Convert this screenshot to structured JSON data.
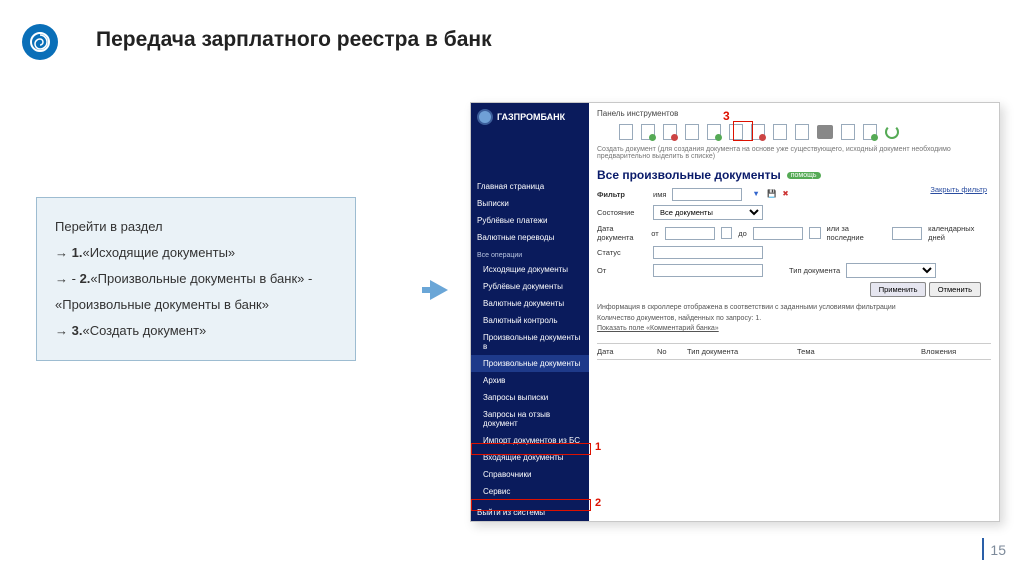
{
  "slide": {
    "title": "Передача зарплатного реестра в банк",
    "page_number": "15"
  },
  "instructions": {
    "lead": "Перейти в раздел",
    "line1_num": "1.",
    "line1_text": "«Исходящие документы»",
    "line2_prefix": "- ",
    "line2_num": "2.",
    "line2_text": "«Произвольные   документы в банк» -",
    "line2_cont": "«Произвольные документы в банк»",
    "line3_num": "3.",
    "line3_text": "«Создать документ»"
  },
  "annotations": {
    "one": "1",
    "two": "2",
    "three": "3"
  },
  "bank_ui": {
    "brand": "ГАЗПРОМБАНК",
    "nav_main": [
      "Главная страница",
      "Выписки",
      "Рублёвые платежи",
      "Валютные переводы"
    ],
    "nav_ops_label": "Все операции",
    "nav_ops": [
      "Исходящие документы",
      "Рублёвые документы",
      "Валютные документы",
      "Валютный контроль",
      "Произвольные документы в",
      "Произвольные документы",
      "Архив",
      "Запросы выписки",
      "Запросы на отзыв документ",
      "Импорт документов из БС",
      "Входящие документы",
      "Справочники",
      "Сервис"
    ],
    "nav_exit": "Выйти из системы",
    "toolbar_label": "Панель инструментов",
    "hint": "Создать документ (для создания документа на основе уже существующего, исходный документ необходимо предварительно выделить в списке)",
    "page_title": "Все произвольные документы",
    "help": "помощь",
    "filter": {
      "label": "Фильтр",
      "alias": "имя",
      "hide": "Закрыть фильтр",
      "state_label": "Состояние",
      "state_value": "Все документы",
      "date_label": "Дата документа",
      "from": "от",
      "to": "до",
      "last_label": "или  за последние",
      "days": "календарных дней",
      "status_label": "Статус",
      "from2": "От",
      "doctype": "Тип документа",
      "apply": "Применить",
      "cancel": "Отменить"
    },
    "info1": "Информация в скроллере отображена в соответствии с заданными условиями фильтрации",
    "info2": "Количество документов, найденных по запросу:  1.",
    "info3": "Показать поле «Комментарий банка»",
    "table_headers": [
      "Дата",
      "No",
      "Тип документа",
      "Тема",
      "Вложения"
    ]
  }
}
